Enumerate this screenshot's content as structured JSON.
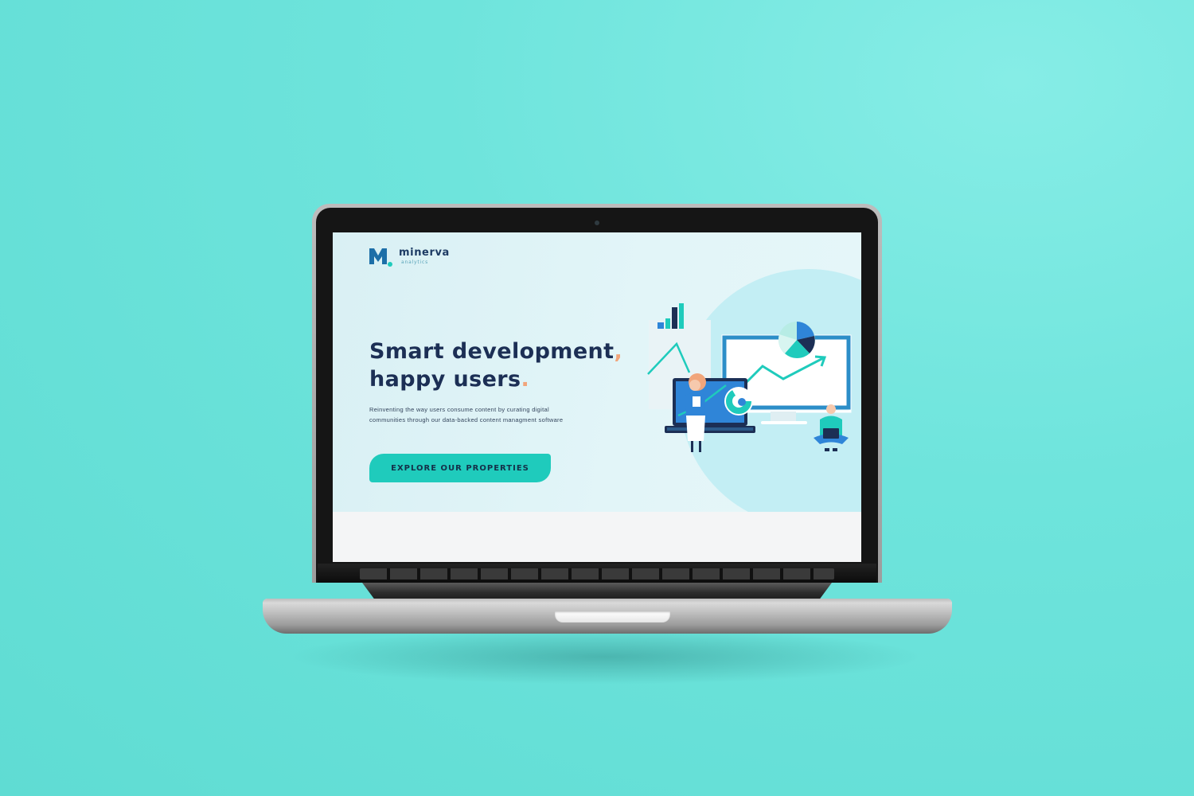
{
  "brand": {
    "name": "minerva",
    "tagline": "analytics",
    "logo_letter": "M",
    "color_primary": "#1d6fa8",
    "color_accent": "#1fcbbc"
  },
  "hero": {
    "headline_line1": "Smart development",
    "headline_line1_mark": ",",
    "headline_line2": "happy users",
    "headline_line2_mark": ".",
    "description": "Reinventing the way users consume content by curating digital communities through our data-backed content managment software",
    "cta_label": "EXPLORE OUR PROPERTIES"
  },
  "colors": {
    "background": "#6ee4dc",
    "headline": "#1c2f55",
    "mark": "#f1a57b",
    "button": "#1fcbbc"
  }
}
